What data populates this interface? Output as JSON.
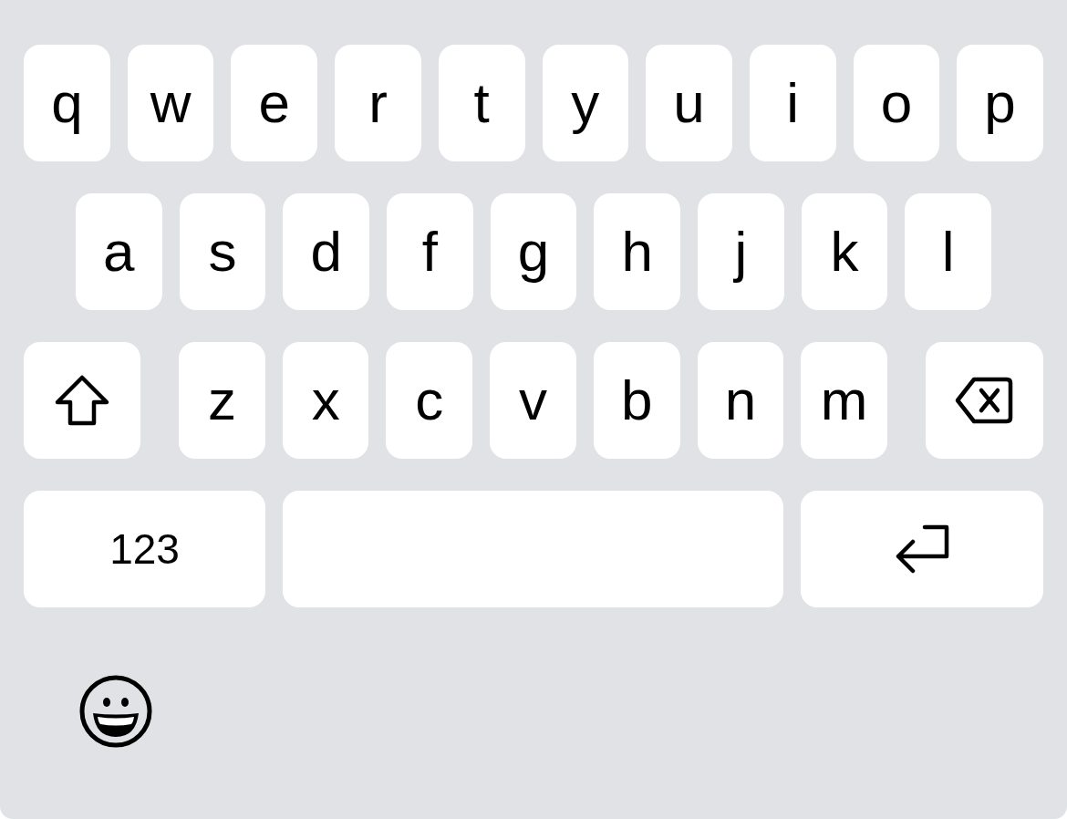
{
  "keyboard": {
    "rows": [
      {
        "keys": [
          {
            "kind": "letter",
            "label": "q"
          },
          {
            "kind": "letter",
            "label": "w"
          },
          {
            "kind": "letter",
            "label": "e"
          },
          {
            "kind": "letter",
            "label": "r"
          },
          {
            "kind": "letter",
            "label": "t"
          },
          {
            "kind": "letter",
            "label": "y"
          },
          {
            "kind": "letter",
            "label": "u"
          },
          {
            "kind": "letter",
            "label": "i"
          },
          {
            "kind": "letter",
            "label": "o"
          },
          {
            "kind": "letter",
            "label": "p"
          }
        ]
      },
      {
        "keys": [
          {
            "kind": "letter",
            "label": "a"
          },
          {
            "kind": "letter",
            "label": "s"
          },
          {
            "kind": "letter",
            "label": "d"
          },
          {
            "kind": "letter",
            "label": "f"
          },
          {
            "kind": "letter",
            "label": "g"
          },
          {
            "kind": "letter",
            "label": "h"
          },
          {
            "kind": "letter",
            "label": "j"
          },
          {
            "kind": "letter",
            "label": "k"
          },
          {
            "kind": "letter",
            "label": "l"
          }
        ]
      },
      {
        "keys": [
          {
            "kind": "shift"
          },
          {
            "kind": "letter",
            "label": "z"
          },
          {
            "kind": "letter",
            "label": "x"
          },
          {
            "kind": "letter",
            "label": "c"
          },
          {
            "kind": "letter",
            "label": "v"
          },
          {
            "kind": "letter",
            "label": "b"
          },
          {
            "kind": "letter",
            "label": "n"
          },
          {
            "kind": "letter",
            "label": "m"
          },
          {
            "kind": "delete"
          }
        ]
      },
      {
        "keys": [
          {
            "kind": "mode",
            "label": "123"
          },
          {
            "kind": "space"
          },
          {
            "kind": "return"
          }
        ]
      }
    ],
    "bottom_bar": {
      "keys": [
        {
          "kind": "emoji"
        }
      ]
    }
  }
}
